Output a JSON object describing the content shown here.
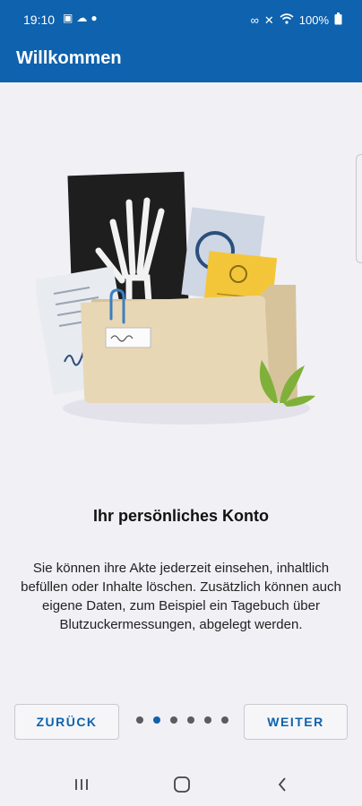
{
  "status": {
    "time": "19:10",
    "left_icons": [
      "photo-icon",
      "cloud-icon",
      "pin-icon"
    ],
    "right_icons": [
      "link-icon",
      "mute-icon",
      "wifi-icon"
    ],
    "battery": "100%"
  },
  "appbar": {
    "title": "Willkommen"
  },
  "onboarding": {
    "heading": "Ihr persönliches Konto",
    "description": "Sie können ihre Akte jederzeit einsehen, inhaltlich befüllen oder Inhalte löschen. Zusätzlich können auch eigene Daten, zum Beispiel ein Tagebuch über Blutzuckermessungen, abgelegt werden.",
    "page_count": 6,
    "current_page_index": 1
  },
  "buttons": {
    "back": "ZURÜCK",
    "next": "WEITER"
  },
  "colors": {
    "primary": "#0e62ae",
    "background": "#f1f0f5",
    "folder": "#e8d7b5",
    "leaf": "#7fb13a",
    "vaccination_card": "#f3c63a"
  },
  "navbar": {
    "icons": [
      "recent-apps-icon",
      "home-icon",
      "back-icon"
    ]
  }
}
